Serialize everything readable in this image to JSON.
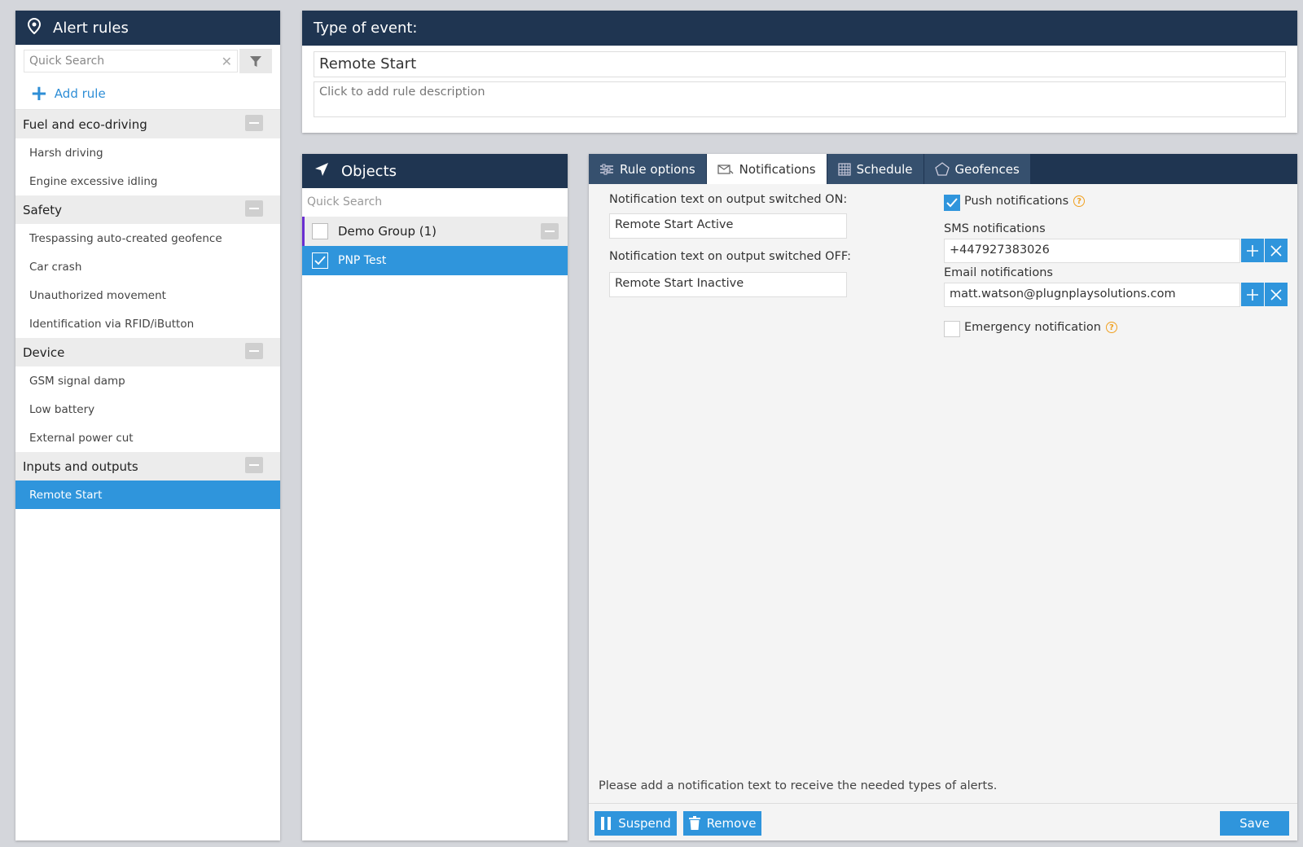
{
  "rules_panel": {
    "title": "Alert rules",
    "search_placeholder": "Quick Search",
    "add_rule": "Add rule",
    "groups": [
      {
        "label": "Fuel and eco-driving",
        "items": [
          "Harsh driving",
          "Engine excessive idling"
        ]
      },
      {
        "label": "Safety",
        "items": [
          "Trespassing auto-created geofence",
          "Car crash",
          "Unauthorized movement",
          "Identification via RFID/iButton"
        ]
      },
      {
        "label": "Device",
        "items": [
          "GSM signal damp",
          "Low battery",
          "External power cut"
        ]
      },
      {
        "label": "Inputs and outputs",
        "items": [
          "Remote Start"
        ]
      }
    ],
    "selected_item": "Remote Start"
  },
  "event_panel": {
    "title": "Type of event:",
    "name": "Remote Start",
    "description_placeholder": "Click to add rule description"
  },
  "objects_panel": {
    "title": "Objects",
    "search_placeholder": "Quick Search",
    "group_label": "Demo Group (1)",
    "item_label": "PNP Test"
  },
  "tabs": {
    "rule_options": "Rule options",
    "notifications": "Notifications",
    "schedule": "Schedule",
    "geofences": "Geofences",
    "active": "Notifications"
  },
  "notifications": {
    "on_label": "Notification text on output switched ON:",
    "on_value": "Remote Start Active",
    "off_label": "Notification text on output switched OFF:",
    "off_value": "Remote Start Inactive",
    "push_label": "Push notifications",
    "push_checked": true,
    "sms_label": "SMS notifications",
    "sms_value": "+447927383026",
    "email_label": "Email notifications",
    "email_value": "matt.watson@plugnplaysolutions.com",
    "emergency_label": "Emergency notification",
    "emergency_checked": false,
    "hint": "Please add a notification text to receive the needed types of alerts."
  },
  "footer": {
    "suspend": "Suspend",
    "remove": "Remove",
    "save": "Save"
  },
  "colors": {
    "header_bg": "#1f3551",
    "accent": "#2f95dc",
    "group_marker": "#6a2fd1",
    "help_icon": "#f0a020"
  }
}
